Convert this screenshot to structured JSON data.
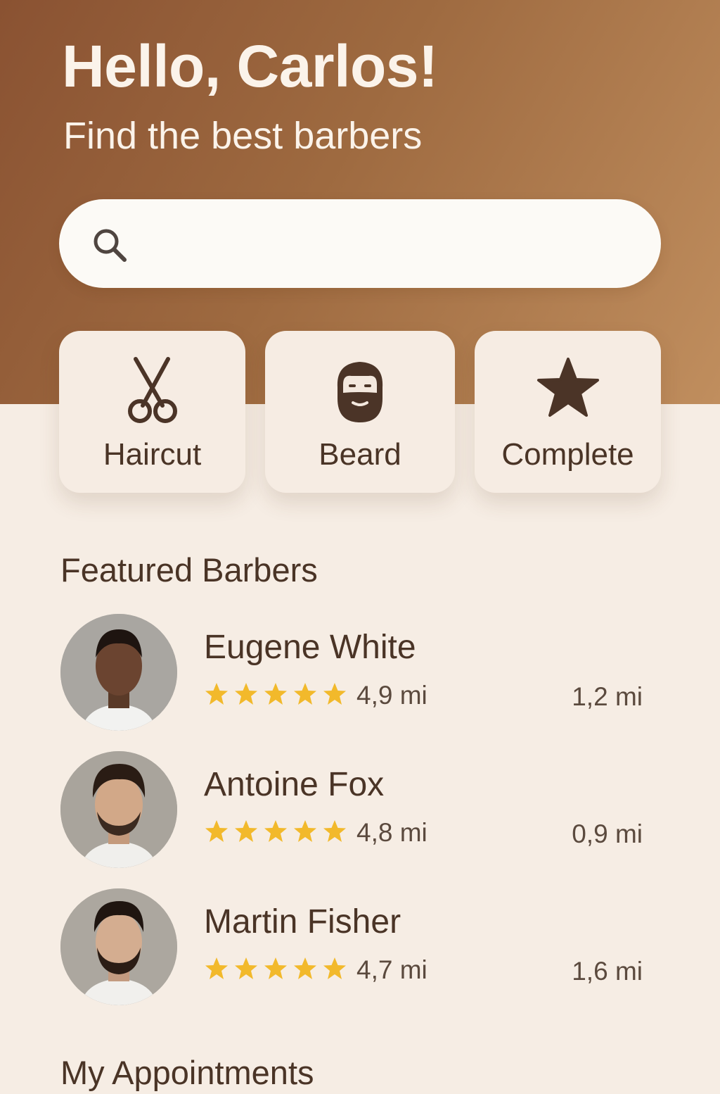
{
  "header": {
    "greeting": "Hello, Carlos!",
    "subtitle": "Find the best barbers"
  },
  "search": {
    "placeholder": "",
    "icon": "search-icon"
  },
  "categories": [
    {
      "label": "Haircut",
      "icon": "scissors-icon"
    },
    {
      "label": "Beard",
      "icon": "bearded-face-icon"
    },
    {
      "label": "Complete",
      "icon": "star-icon"
    }
  ],
  "featured": {
    "title": "Featured Barbers",
    "barbers": [
      {
        "name": "Eugene White",
        "rating": "4,9 mi",
        "stars": 5,
        "distance": "1,2 mi"
      },
      {
        "name": "Antoine Fox",
        "rating": "4,8 mi",
        "stars": 5,
        "distance": "0,9 mi"
      },
      {
        "name": "Martin Fisher",
        "rating": "4,7 mi",
        "stars": 5,
        "distance": "1,6 mi"
      }
    ]
  },
  "appointments": {
    "title": "My Appointments"
  },
  "colors": {
    "header_gradient_start": "#8a5232",
    "header_gradient_end": "#c08e5e",
    "background": "#f6ede4",
    "text_dark": "#4a3426",
    "star": "#f2b92b"
  }
}
